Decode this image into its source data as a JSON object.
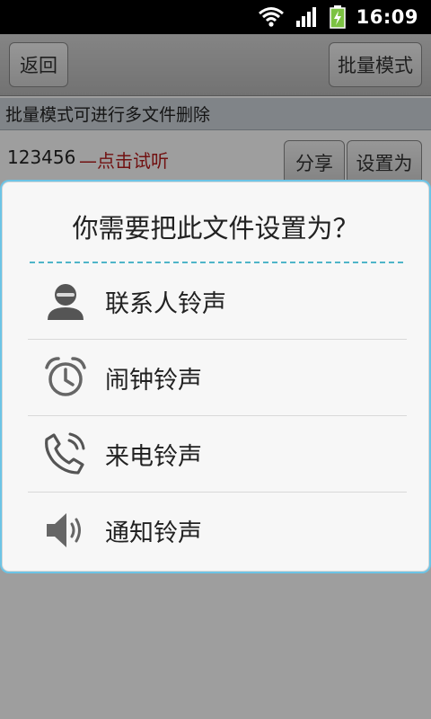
{
  "status_bar": {
    "time": "16:09"
  },
  "toolbar": {
    "back_label": "返回",
    "batch_label": "批量模式"
  },
  "hint": "批量模式可进行多文件删除",
  "file_row": {
    "name": "123456",
    "listen_label": "—点击试听",
    "share_label": "分享",
    "set_as_label": "设置为"
  },
  "dialog": {
    "title": "你需要把此文件设置为？",
    "options": [
      {
        "label": "联系人铃声",
        "icon": "contact-icon"
      },
      {
        "label": "闹钟铃声",
        "icon": "alarm-clock-icon"
      },
      {
        "label": "来电铃声",
        "icon": "phone-icon"
      },
      {
        "label": "通知铃声",
        "icon": "speaker-icon"
      }
    ]
  },
  "colors": {
    "dialog_accent": "#4fb5c8",
    "listen_text": "#b71c1c"
  }
}
